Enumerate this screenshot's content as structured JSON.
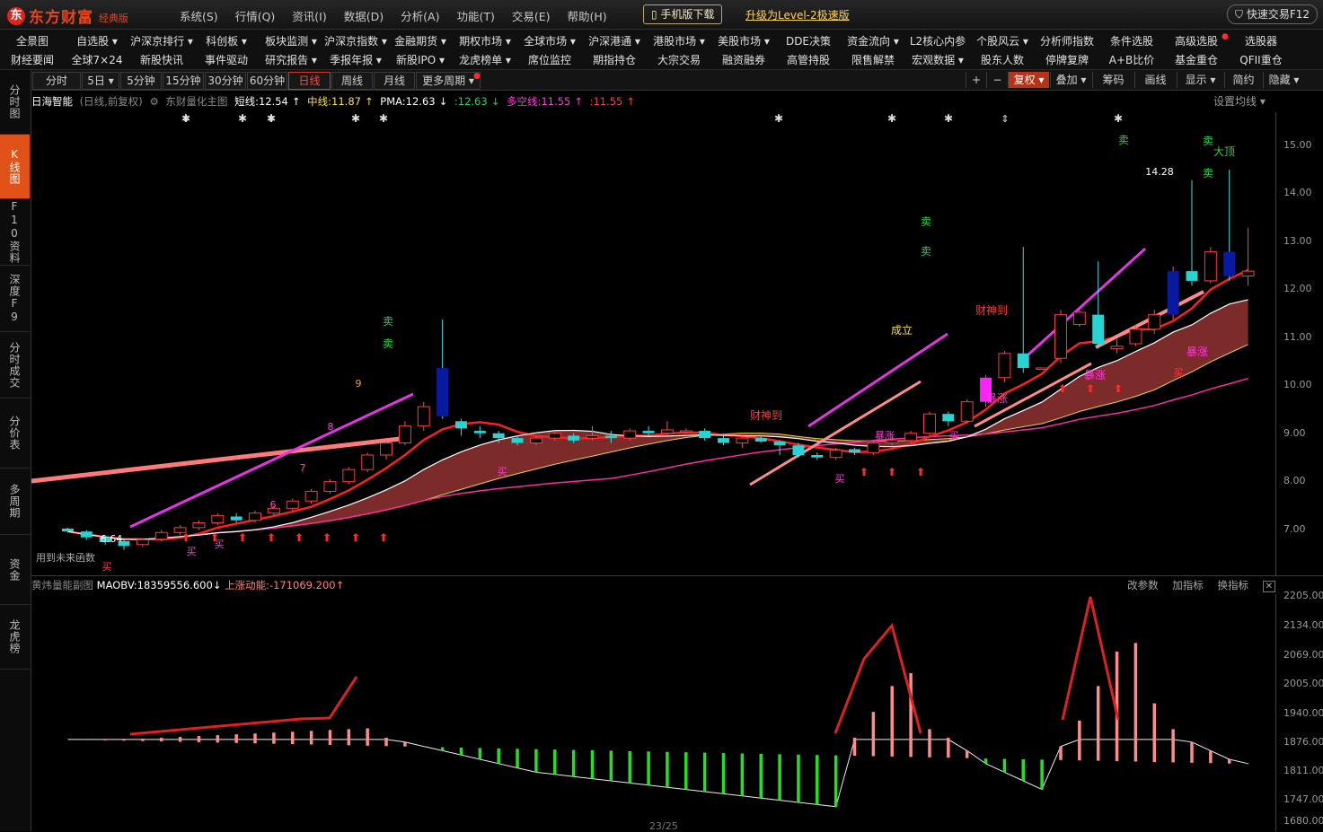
{
  "brand": {
    "logo": "东",
    "name": "东方财富",
    "edition": "经典版"
  },
  "top_menu": [
    "系统(S)",
    "行情(Q)",
    "资讯(I)",
    "数据(D)",
    "分析(A)",
    "功能(T)",
    "交易(E)",
    "帮助(H)"
  ],
  "mobile_download": "手机版下载",
  "upgrade_link": "升级为Level-2极速版",
  "quick_trade": "快速交易F12",
  "nav_row1": [
    "全景图",
    "自选股 ▾",
    "沪深京排行 ▾",
    "科创板 ▾",
    "板块监测 ▾",
    "沪深京指数 ▾",
    "金融期货 ▾",
    "期权市场 ▾",
    "全球市场 ▾",
    "沪深港通 ▾",
    "港股市场 ▾",
    "美股市场 ▾",
    "DDE决策",
    "资金流向 ▾",
    "L2核心内参",
    "个股风云 ▾",
    "分析师指数",
    "条件选股",
    "高级选股",
    "选股器"
  ],
  "nav_row2": [
    "财经要闻",
    "全球7×24",
    "新股快讯",
    "事件驱动",
    "研究报告 ▾",
    "季报年报 ▾",
    "新股IPO ▾",
    "龙虎榜单 ▾",
    "席位监控",
    "期指持仓",
    "大宗交易",
    "融资融券",
    "高管持股",
    "限售解禁",
    "宏观数据 ▾",
    "股东人数",
    "停牌复牌",
    "A+B比价",
    "基金重仓",
    "QFII重仓"
  ],
  "sidebar_tabs": [
    "分时图",
    "K线图",
    "F10资料",
    "深度F9",
    "分时成交",
    "分价表",
    "多周期",
    "资金",
    "龙虎榜"
  ],
  "periods": [
    "分时",
    "5日 ▾",
    "5分钟",
    "15分钟",
    "30分钟",
    "60分钟",
    "日线",
    "周线",
    "月线",
    "更多周期 ▾"
  ],
  "tools": [
    "+",
    "−",
    "复权 ▾",
    "叠加 ▾",
    "筹码",
    "画线",
    "显示 ▾",
    "简约",
    "隐藏 ▾"
  ],
  "info": {
    "stock_name": "日海智能",
    "period_desc": "(日线,前复权)",
    "indicator_name": "东财量化主图",
    "short_line": "短线:12.54",
    "short_arrow": "↑",
    "mid_line": "中线:11.87",
    "mid_arrow": "↑",
    "pma": "PMA:12.63",
    "pma_arrow": "↓",
    "pma2": ":12.63",
    "pma2_arrow": "↓",
    "longshort": "多空线:11.55",
    "longshort_arrow": "↑",
    "longshort2": ":11.55",
    "longshort2_arrow": "↑",
    "ma_settings": "设置均线 ▾"
  },
  "sub_info": {
    "indicator_name": "黄炜量能副图",
    "maobv": "MAOBV:18359556.600",
    "maobv_arrow": "↓",
    "momentum": "上涨动能:-171069.200",
    "momentum_arrow": "↑",
    "btn_params": "改参数",
    "btn_add": "加指标",
    "btn_change": "换指标",
    "btn_close": "✕"
  },
  "main_axis_labels": [
    "15.00",
    "14.00",
    "13.00",
    "12.00",
    "11.00",
    "10.00",
    "9.00",
    "8.00",
    "7.00"
  ],
  "sub_axis_labels": [
    "2205.00",
    "2134.00",
    "2069.00",
    "2005.00",
    "1940.00",
    "1876.00",
    "1811.00",
    "1747.00",
    "1680.00"
  ],
  "page_count": "23/25",
  "annotations": {
    "low_price": "6.64",
    "high_price": "14.28",
    "future_fn": "用到未来函数",
    "sell": "卖",
    "buy": "买",
    "caishen": "财神到",
    "chengli": "成立",
    "baozhang": "暴涨",
    "dading": "大顶",
    "num9": "9",
    "num6": "6",
    "num7": "7",
    "num8": "8"
  },
  "colors": {
    "up": "#ff3a3a",
    "down": "#27d34a",
    "accent": "#e05218",
    "ribbon": "#8a3030"
  },
  "chart_data": {
    "type": "candlestick",
    "price_range": [
      6.3,
      15.5
    ],
    "candles": [
      [
        7.08,
        7.02,
        7.1,
        7.0
      ],
      [
        7.02,
        6.9,
        7.05,
        6.85
      ],
      [
        6.9,
        6.8,
        6.92,
        6.75
      ],
      [
        6.82,
        6.72,
        6.85,
        6.64
      ],
      [
        6.75,
        6.85,
        6.88,
        6.7
      ],
      [
        6.86,
        7.0,
        7.05,
        6.82
      ],
      [
        7.0,
        7.1,
        7.15,
        6.95
      ],
      [
        7.1,
        7.2,
        7.25,
        7.05
      ],
      [
        7.2,
        7.35,
        7.4,
        7.15
      ],
      [
        7.33,
        7.25,
        7.4,
        7.2
      ],
      [
        7.25,
        7.4,
        7.45,
        7.2
      ],
      [
        7.4,
        7.5,
        7.55,
        7.35
      ],
      [
        7.5,
        7.65,
        7.7,
        7.45
      ],
      [
        7.65,
        7.85,
        7.9,
        7.6
      ],
      [
        7.85,
        8.05,
        8.1,
        7.8
      ],
      [
        8.05,
        8.3,
        8.35,
        8.0
      ],
      [
        8.3,
        8.6,
        8.65,
        8.25
      ],
      [
        8.6,
        8.85,
        8.9,
        8.5
      ],
      [
        8.85,
        9.2,
        9.3,
        8.8
      ],
      [
        9.2,
        9.6,
        9.7,
        9.1
      ],
      [
        10.4,
        9.4,
        11.4,
        9.35
      ],
      [
        9.3,
        9.15,
        9.35,
        9.0
      ],
      [
        9.1,
        9.05,
        9.2,
        8.95
      ],
      [
        9.05,
        8.95,
        9.1,
        8.85
      ],
      [
        8.95,
        8.85,
        9.0,
        8.8
      ],
      [
        8.85,
        8.95,
        9.0,
        8.8
      ],
      [
        8.95,
        9.05,
        9.1,
        8.9
      ],
      [
        9.0,
        8.9,
        9.05,
        8.85
      ],
      [
        8.95,
        9.0,
        9.2,
        8.9
      ],
      [
        9.0,
        8.95,
        9.1,
        8.85
      ],
      [
        8.95,
        9.1,
        9.15,
        8.9
      ],
      [
        9.1,
        9.05,
        9.2,
        9.0
      ],
      [
        9.05,
        9.12,
        9.3,
        9.0
      ],
      [
        9.1,
        9.1,
        9.15,
        9.05
      ],
      [
        9.1,
        8.95,
        9.15,
        8.9
      ],
      [
        8.95,
        8.85,
        9.0,
        8.8
      ],
      [
        8.85,
        8.95,
        9.0,
        8.75
      ],
      [
        8.95,
        8.88,
        9.0,
        8.85
      ],
      [
        8.88,
        8.8,
        8.9,
        8.6
      ],
      [
        8.8,
        8.6,
        8.85,
        8.55
      ],
      [
        8.6,
        8.55,
        8.65,
        8.5
      ],
      [
        8.55,
        8.7,
        8.75,
        8.5
      ],
      [
        8.72,
        8.65,
        8.75,
        8.6
      ],
      [
        8.65,
        8.85,
        8.9,
        8.6
      ],
      [
        8.85,
        8.9,
        9.0,
        8.8
      ],
      [
        8.9,
        9.05,
        9.1,
        8.85
      ],
      [
        9.05,
        9.45,
        9.5,
        9.0
      ],
      [
        9.45,
        9.3,
        9.5,
        9.2
      ],
      [
        9.3,
        9.7,
        9.75,
        9.25
      ],
      [
        9.7,
        10.2,
        10.25,
        9.6
      ],
      [
        10.2,
        10.7,
        10.75,
        10.1
      ],
      [
        10.7,
        10.4,
        12.9,
        10.3
      ],
      [
        10.4,
        10.4,
        10.4,
        10.4
      ],
      [
        10.6,
        11.5,
        11.6,
        10.5
      ],
      [
        11.3,
        11.55,
        11.6,
        11.25
      ],
      [
        11.5,
        10.9,
        12.6,
        10.8
      ],
      [
        10.8,
        10.85,
        11.0,
        10.7
      ],
      [
        10.9,
        11.2,
        11.3,
        10.85
      ],
      [
        11.2,
        11.5,
        11.6,
        11.1
      ],
      [
        11.5,
        12.4,
        12.5,
        11.4
      ],
      [
        12.4,
        12.2,
        14.28,
        12.1
      ],
      [
        12.2,
        12.8,
        12.9,
        12.15
      ],
      [
        12.8,
        12.3,
        14.5,
        12.2
      ],
      [
        12.3,
        12.4,
        13.3,
        12.1
      ]
    ],
    "volume_indicator": "MAOBV",
    "maobv_values": [
      1876,
      1876,
      1876,
      1876,
      1878,
      1880,
      1882,
      1884,
      1886,
      1888,
      1890,
      1892,
      1894,
      1896,
      1898,
      1900,
      1902,
      1880,
      1870,
      1860,
      1850,
      1840,
      1830,
      1820,
      1810,
      1800,
      1795,
      1790,
      1785,
      1780,
      1775,
      1770,
      1765,
      1760,
      1755,
      1750,
      1745,
      1740,
      1735,
      1730,
      1725,
      1720,
      1880,
      1940,
      2000,
      2030,
      1900,
      1880,
      1850,
      1820,
      1800,
      1780,
      1760,
      1860,
      1920,
      2000,
      2080,
      2100,
      1960,
      1900,
      1870,
      1850,
      1830,
      1820
    ]
  }
}
